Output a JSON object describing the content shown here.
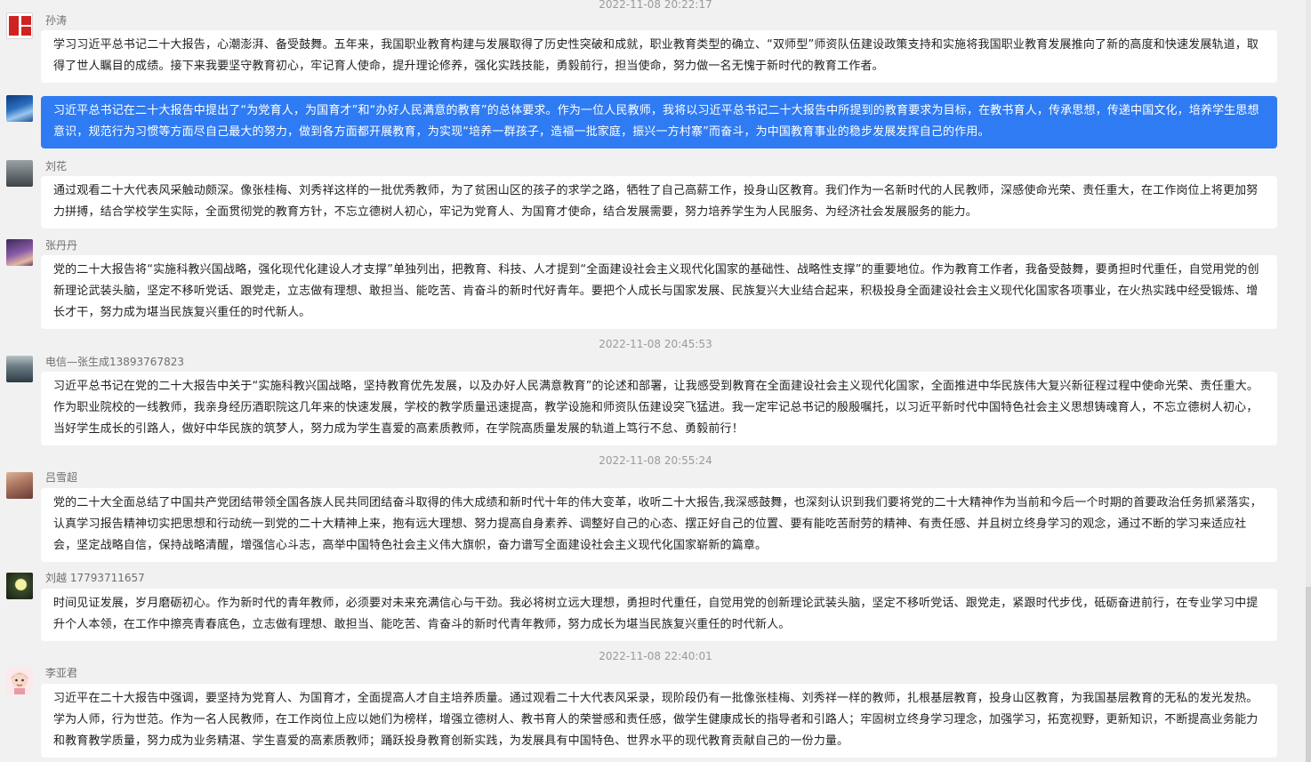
{
  "timestamps": [
    "2022-11-08 20:22:17",
    "2022-11-08 20:45:53",
    "2022-11-08 20:55:24",
    "2022-11-08 22:40:01"
  ],
  "messages": [
    {
      "sender": "孙涛",
      "avatar": "red-seal-avatar",
      "text": "学习习近平总书记二十大报告，心潮澎湃、备受鼓舞。五年来，我国职业教育构建与发展取得了历史性突破和成就，职业教育类型的确立、“双师型”师资队伍建设政策支持和实施将我国职业教育发展推向了新的高度和快速发展轨道，取得了世人瞩目的成绩。接下来我要坚守教育初心，牢记育人使命，提升理论修养，强化实践技能，勇毅前行，担当使命，努力做一名无愧于新时代的教育工作者。"
    },
    {
      "sender": "",
      "avatar": "sky-avatar",
      "self": true,
      "text": "习近平总书记在二十大报告中提出了“为党育人，为国育才”和“办好人民满意的教育”的总体要求。作为一位人民教师，我将以习近平总书记二十大报告中所提到的教育要求为目标，在教书育人，传承思想，传递中国文化，培养学生思想意识，规范行为习惯等方面尽自己最大的努力，做到各方面都开展教育，为实现“培养一群孩子，造福一批家庭，振兴一方村寨”而奋斗，为中国教育事业的稳步发展发挥自己的作用。"
    },
    {
      "sender": "刘花",
      "avatar": "man-avatar",
      "text": "通过观看二十大代表风采触动颇深。像张桂梅、刘秀祥这样的一批优秀教师，为了贫困山区的孩子的求学之路，牺牲了自己高薪工作，投身山区教育。我们作为一名新时代的人民教师，深感使命光荣、责任重大，在工作岗位上将更加努力拼搏，结合学校学生实际，全面贯彻党的教育方针，不忘立德树人初心，牢记为党育人、为国育才使命，结合发展需要，努力培养学生为人民服务、为经济社会发展服务的能力。"
    },
    {
      "sender": "张丹丹",
      "avatar": "purple-avatar",
      "text": "党的二十大报告将“实施科教兴国战略，强化现代化建设人才支撑”单独列出，把教育、科技、人才提到“全面建设社会主义现代化国家的基础性、战略性支撑”的重要地位。作为教育工作者，我备受鼓舞，要勇担时代重任，自觉用党的创新理论武装头脑，坚定不移听党话、跟党走，立志做有理想、敢担当、能吃苦、肯奋斗的新时代好青年。要把个人成长与国家发展、民族复兴大业结合起来，积极投身全面建设社会主义现代化国家各项事业，在火热实践中经受锻炼、增长才干，努力成为堪当民族复兴重任的时代新人。"
    },
    {
      "sender": "电信—张生成13893767823",
      "avatar": "man2-avatar",
      "text": "习近平总书记在党的二十大报告中关于“实施科教兴国战略，坚持教育优先发展，以及办好人民满意教育”的论述和部署，让我感受到教育在全面建设社会主义现代化国家，全面推进中华民族伟大复兴新征程过程中使命光荣、责任重大。作为职业院校的一线教师，我亲身经历酒职院这几年来的快速发展，学校的教学质量迅速提高，教学设施和师资队伍建设突飞猛进。我一定牢记总书记的殷殷嘱托，以习近平新时代中国特色社会主义思想铸魂育人，不忘立德树人初心，当好学生成长的引路人，做好中华民族的筑梦人，努力成为学生喜爱的高素质教师，在学院高质量发展的轨道上笃行不怠、勇毅前行！"
    },
    {
      "sender": "吕雪超",
      "avatar": "girl-avatar",
      "text": "党的二十大全面总结了中国共产党团结带领全国各族人民共同团结奋斗取得的伟大成绩和新时代十年的伟大变革，收听二十大报告,我深感鼓舞，也深刻认识到我们要将党的二十大精神作为当前和今后一个时期的首要政治任务抓紧落实，认真学习报告精神切实把思想和行动统一到党的二十大精神上来，抱有远大理想、努力提高自身素养、调整好自己的心态、摆正好自己的位置、要有能吃苦耐劳的精神、有责任感、并且树立终身学习的观念，通过不断的学习来适应社会，坚定战略自信，保持战略清醒，增强信心斗志，高举中国特色社会主义伟大旗帜，奋力谱写全面建设社会主义现代化国家崭新的篇章。"
    },
    {
      "sender": "刘越 17793711657",
      "avatar": "moon-avatar",
      "text": "时间见证发展，岁月磨砺初心。作为新时代的青年教师，必须要对未来充满信心与干劲。我必将树立远大理想，勇担时代重任，自觉用党的创新理论武装头脑，坚定不移听党话、跟党走，紧跟时代步伐，砥砺奋进前行，在专业学习中提升个人本领，在工作中擦亮青春底色，立志做有理想、敢担当、能吃苦、肯奋斗的新时代青年教师，努力成长为堪当民族复兴重任的时代新人。"
    },
    {
      "sender": "李亚君",
      "avatar": "cartoon-girl-avatar",
      "text": "习近平在二十大报告中强调，要坚持为党育人、为国育才，全面提高人才自主培养质量。通过观看二十大代表风采录，现阶段仍有一批像张桂梅、刘秀祥一样的教师，扎根基层教育，投身山区教育，为我国基层教育的无私的发光发热。学为人师，行为世范。作为一名人民教师，在工作岗位上应以她们为榜样，增强立德树人、教书育人的荣誉感和责任感，做学生健康成长的指导者和引路人；牢固树立终身学习理念，加强学习，拓宽视野，更新知识，不断提高业务能力和教育教学质量，努力成为业务精湛、学生喜爱的高素质教师；踊跃投身教育创新实践，为发展具有中国特色、世界水平的现代教育贡献自己的一份力量。"
    }
  ]
}
